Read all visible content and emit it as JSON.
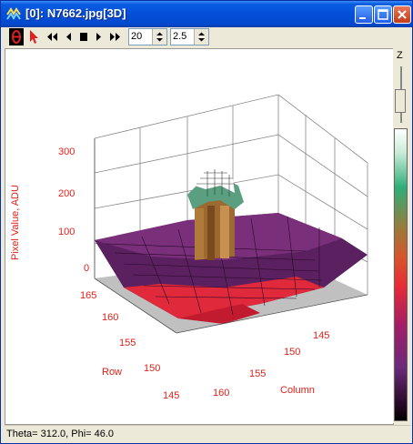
{
  "window": {
    "title": "[0]: N7662.jpg[3D]"
  },
  "toolbar": {
    "frames_value": "20",
    "step_value": "2.5"
  },
  "zpanel": {
    "label": "Z"
  },
  "plot": {
    "z_axis_title": "Pixel Value, ADU",
    "z_ticks": [
      "300",
      "200",
      "100",
      "0"
    ],
    "row_axis_title": "Row",
    "row_ticks": [
      "165",
      "160",
      "155",
      "150",
      "145"
    ],
    "col_axis_title": "Column",
    "col_ticks": [
      "160",
      "155",
      "150",
      "145"
    ]
  },
  "status": {
    "text": "Theta= 312.0, Phi= 46.0"
  },
  "colors": {
    "title_active": "#0450d8",
    "axis_label": "#e0201a",
    "floor": "#c0c0c0"
  }
}
